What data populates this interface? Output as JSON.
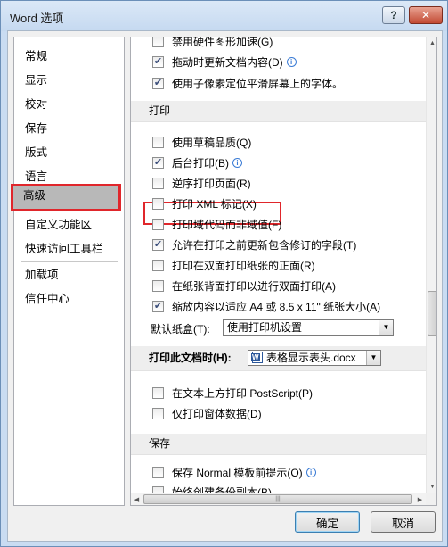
{
  "window": {
    "title": "Word 选项",
    "help": "?",
    "close": "✕"
  },
  "nav": {
    "items": [
      "常规",
      "显示",
      "校对",
      "保存",
      "版式",
      "语言",
      "高级",
      "自定义功能区",
      "快速访问工具栏",
      "加载项",
      "信任中心"
    ],
    "selected_index": 6
  },
  "options": {
    "top_rows": [
      {
        "label": "禁用硬件图形加速(G)",
        "checked": false
      },
      {
        "label": "拖动时更新文档内容(D)",
        "checked": true,
        "info": true
      },
      {
        "label": "使用子像素定位平滑屏幕上的字体。",
        "checked": true
      }
    ],
    "print_section": "打印",
    "print_rows": [
      {
        "label": "使用草稿品质(Q)",
        "checked": false
      },
      {
        "label": "后台打印(B)",
        "checked": true,
        "info": true
      },
      {
        "label": "逆序打印页面(R)",
        "checked": false
      },
      {
        "label": "打印 XML 标记(X)",
        "checked": false
      },
      {
        "label": "打印域代码而非域值(F)",
        "checked": false
      },
      {
        "label": "允许在打印之前更新包含修订的字段(T)",
        "checked": true
      },
      {
        "label": "打印在双面打印纸张的正面(R)",
        "checked": false
      },
      {
        "label": "在纸张背面打印以进行双面打印(A)",
        "checked": false
      },
      {
        "label": "缩放内容以适应 A4 或 8.5 x 11\" 纸张大小(A)",
        "checked": true
      }
    ],
    "default_tray_label": "默认纸盒(T):",
    "default_tray_value": "使用打印机设置",
    "print_doc_label": "打印此文档时(H):",
    "print_doc_value": "表格显示表头.docx",
    "print_doc_rows": [
      {
        "label": "在文本上方打印 PostScript(P)",
        "checked": false
      },
      {
        "label": "仅打印窗体数据(D)",
        "checked": false
      }
    ],
    "save_section": "保存",
    "save_rows": [
      {
        "label": "保存 Normal 模板前提示(O)",
        "checked": false,
        "info": true
      },
      {
        "label": "始终创建备份副本(B)",
        "checked": false
      }
    ]
  },
  "buttons": {
    "ok": "确定",
    "cancel": "取消"
  }
}
